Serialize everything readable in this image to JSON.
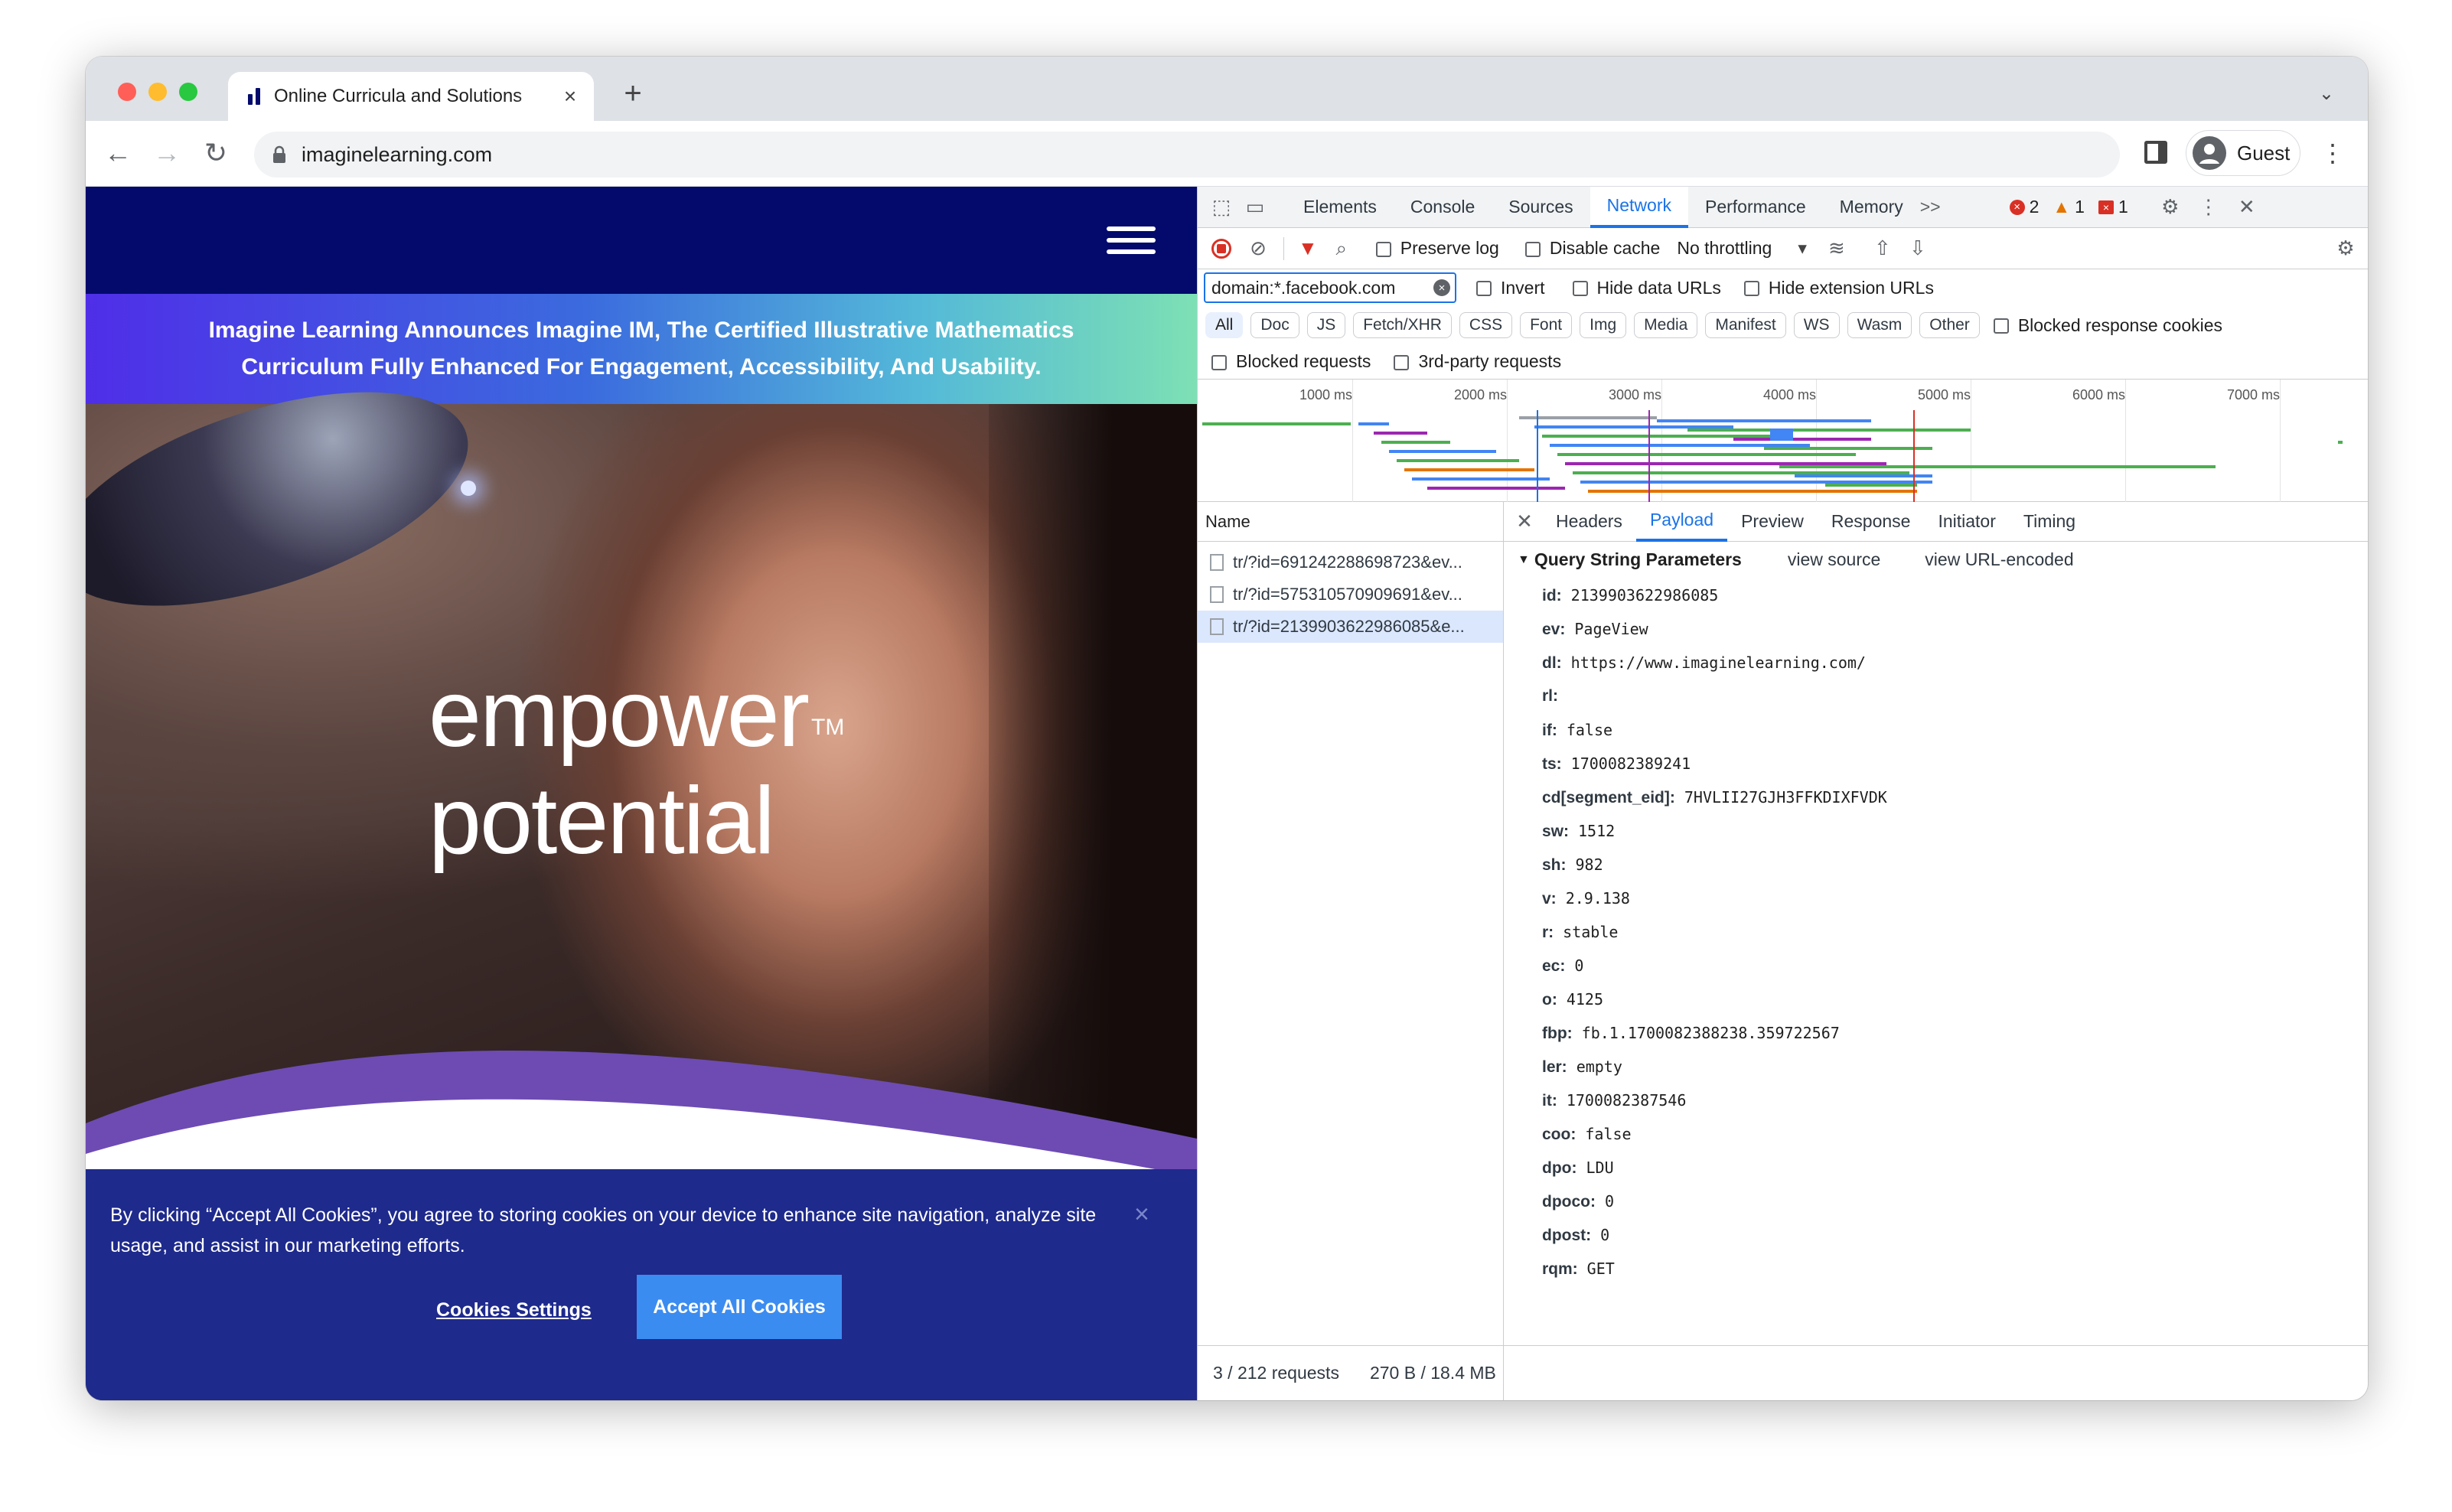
{
  "browser": {
    "tab_title": "Online Curricula and Solutions",
    "tab_close": "×",
    "new_tab": "+",
    "url": "imaginelearning.com",
    "profile_name": "Guest",
    "tab_menu": "⌄"
  },
  "site": {
    "banner": "Imagine Learning Announces Imagine IM, The Certified Illustrative Mathematics Curriculum Fully Enhanced For Engagement, Accessibility, And Usability.",
    "hero_line1": "empower",
    "hero_line2": "potential",
    "hero_tm": "TM",
    "cookie_text": "By clicking “Accept All Cookies”, you agree to storing cookies on your device to enhance site navigation, analyze site usage, and assist in our marketing efforts.",
    "cookie_settings": "Cookies Settings",
    "cookie_accept": "Accept All Cookies",
    "cookie_close": "×"
  },
  "devtools": {
    "tabs": [
      "Elements",
      "Console",
      "Sources",
      "Network",
      "Performance",
      "Memory"
    ],
    "more_tabs": ">>",
    "errors": "2",
    "warnings": "1",
    "issues": "1",
    "preserve_log": "Preserve log",
    "disable_cache": "Disable cache",
    "throttling": "No throttling",
    "filter_value": "domain:*.facebook.com",
    "invert": "Invert",
    "hide_data_urls": "Hide data URLs",
    "hide_extension_urls": "Hide extension URLs",
    "type_filters": [
      "All",
      "Doc",
      "JS",
      "Fetch/XHR",
      "CSS",
      "Font",
      "Img",
      "Media",
      "Manifest",
      "WS",
      "Wasm",
      "Other"
    ],
    "blocked_response_cookies": "Blocked response cookies",
    "blocked_requests": "Blocked requests",
    "third_party_requests": "3rd-party requests",
    "timeline_ticks": [
      "1000 ms",
      "2000 ms",
      "3000 ms",
      "4000 ms",
      "5000 ms",
      "6000 ms",
      "7000 ms"
    ],
    "name_header": "Name",
    "requests": [
      "tr/?id=691242288698723&ev...",
      "tr/?id=575310570909691&ev...",
      "tr/?id=2139903622986085&e..."
    ],
    "detail_tabs": [
      "Headers",
      "Payload",
      "Preview",
      "Response",
      "Initiator",
      "Timing"
    ],
    "qs_title": "Query String Parameters",
    "view_source": "view source",
    "view_url_encoded": "view URL-encoded",
    "params": [
      {
        "key": "id:",
        "value": "2139903622986085"
      },
      {
        "key": "ev:",
        "value": "PageView"
      },
      {
        "key": "dl:",
        "value": "https://www.imaginelearning.com/"
      },
      {
        "key": "rl:",
        "value": ""
      },
      {
        "key": "if:",
        "value": "false"
      },
      {
        "key": "ts:",
        "value": "1700082389241"
      },
      {
        "key": "cd[segment_eid]:",
        "value": "7HVLII27GJH3FFKDIXFVDK"
      },
      {
        "key": "sw:",
        "value": "1512"
      },
      {
        "key": "sh:",
        "value": "982"
      },
      {
        "key": "v:",
        "value": "2.9.138"
      },
      {
        "key": "r:",
        "value": "stable"
      },
      {
        "key": "ec:",
        "value": "0"
      },
      {
        "key": "o:",
        "value": "4125"
      },
      {
        "key": "fbp:",
        "value": "fb.1.1700082388238.359722567"
      },
      {
        "key": "ler:",
        "value": "empty"
      },
      {
        "key": "it:",
        "value": "1700082387546"
      },
      {
        "key": "coo:",
        "value": "false"
      },
      {
        "key": "dpo:",
        "value": "LDU"
      },
      {
        "key": "dpoco:",
        "value": "0"
      },
      {
        "key": "dpost:",
        "value": "0"
      },
      {
        "key": "rqm:",
        "value": "GET"
      }
    ],
    "status_requests": "3 / 212 requests",
    "status_size": "270 B / 18.4 MB"
  },
  "colors": {
    "accent": "#1a73e8",
    "site_header": "#030a6c",
    "cookie_bg": "#1e2a8c",
    "cookie_button": "#3b8cf0",
    "error": "#d93025",
    "warning": "#e37400"
  }
}
